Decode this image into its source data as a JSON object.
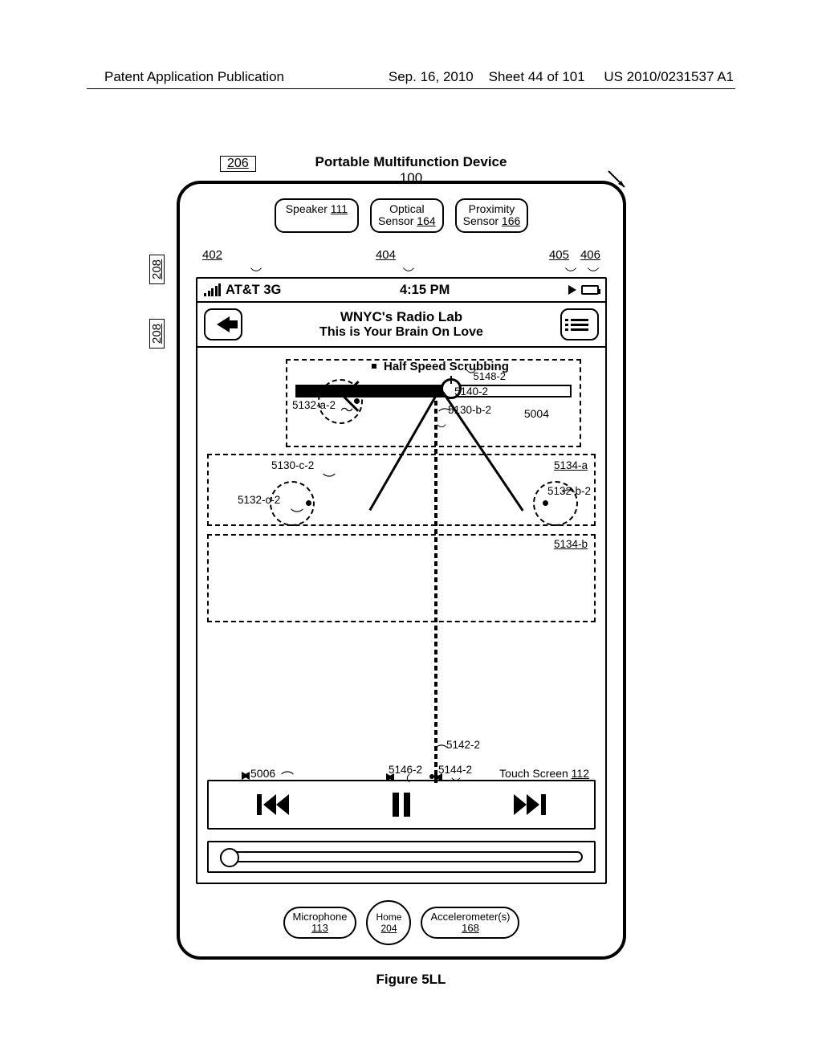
{
  "header": {
    "left": "Patent Application Publication",
    "date": "Sep. 16, 2010",
    "sheet": "Sheet 44 of 101",
    "docnum": "US 2010/0231537 A1"
  },
  "device": {
    "title": "Portable Multifunction Device",
    "ref_100": "100",
    "ref_206": "206",
    "side_208": "208",
    "speaker": {
      "label": "Speaker",
      "num": "111"
    },
    "optical": {
      "label1": "Optical",
      "label2": "Sensor",
      "num": "164"
    },
    "proximity": {
      "label1": "Proximity",
      "label2": "Sensor",
      "num": "166"
    },
    "microphone": {
      "label": "Microphone",
      "num": "113"
    },
    "home": {
      "label": "Home",
      "num": "204"
    },
    "accel": {
      "label": "Accelerometer(s)",
      "num": "168"
    }
  },
  "status": {
    "carrier": "AT&T 3G",
    "time": "4:15 PM"
  },
  "refs_top": {
    "r402": "402",
    "r404": "404",
    "r405": "405",
    "r406": "406"
  },
  "nav": {
    "title1": "WNYC's Radio Lab",
    "title2": "This is Your Brain On Love"
  },
  "scrub": {
    "label": "Half Speed Scrubbing"
  },
  "refs": {
    "r5004": "5004",
    "r5148_2": "5148-2",
    "r5132_a_2": "5132-a-2",
    "r5140_2": "5140-2",
    "r5130_b_2": "5130-b-2",
    "r5130_c_2": "5130-c-2",
    "r5132_c_2": "5132-c-2",
    "r5134_a": "5134-a",
    "r5132_b_2": "5132-b-2",
    "r5134_b": "5134-b",
    "r5142_2": "5142-2",
    "r5006": "5006",
    "r5146_2": "5146-2",
    "r5144_2": "5144-2",
    "touchscreen": "Touch Screen",
    "ts_num": "112"
  },
  "figure": "Figure 5LL"
}
